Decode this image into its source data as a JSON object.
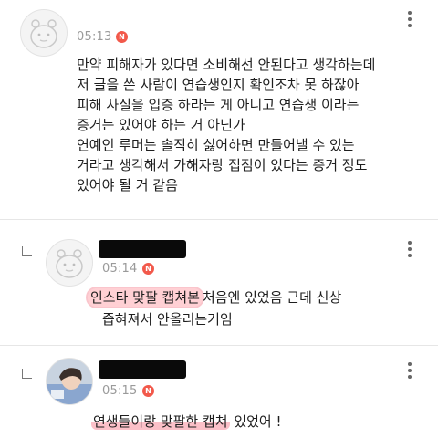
{
  "comments": [
    {
      "time": "05:13",
      "badge": "N",
      "avatar": "default-face-icon",
      "lines": [
        "만약 피해자가 있다면 소비해선 안된다고 생각하는데",
        "저 글을 쓴 사람이 연습생인지 확인조차 못 하잖아",
        "피해 사실을 입증 하라는 게 아니고 연습생 이라는",
        "증거는 있어야 하는 거 아닌가",
        "연예인 루머는 솔직히 싫어하면 만들어낼 수 있는",
        "거라고 생각해서 가해자랑 접점이 있다는 증거 정도",
        "있어야 될 거 같음"
      ]
    },
    {
      "time": "05:14",
      "badge": "N",
      "avatar": "default-face-icon",
      "highlight": "인스타 맞팔 캡쳐본",
      "rest_line1": "처음엔 있었음 근데 신상",
      "line2": "좁혀져서 안올리는거임"
    },
    {
      "time": "05:15",
      "badge": "N",
      "avatar": "photo-avatar",
      "highlight": "연생들이랑 맞팔한 캡쳐",
      "rest": "있었어 !"
    }
  ],
  "colors": {
    "badge": "#f2594b",
    "highlight": "#f68c9b",
    "time": "#9a9a9a"
  }
}
